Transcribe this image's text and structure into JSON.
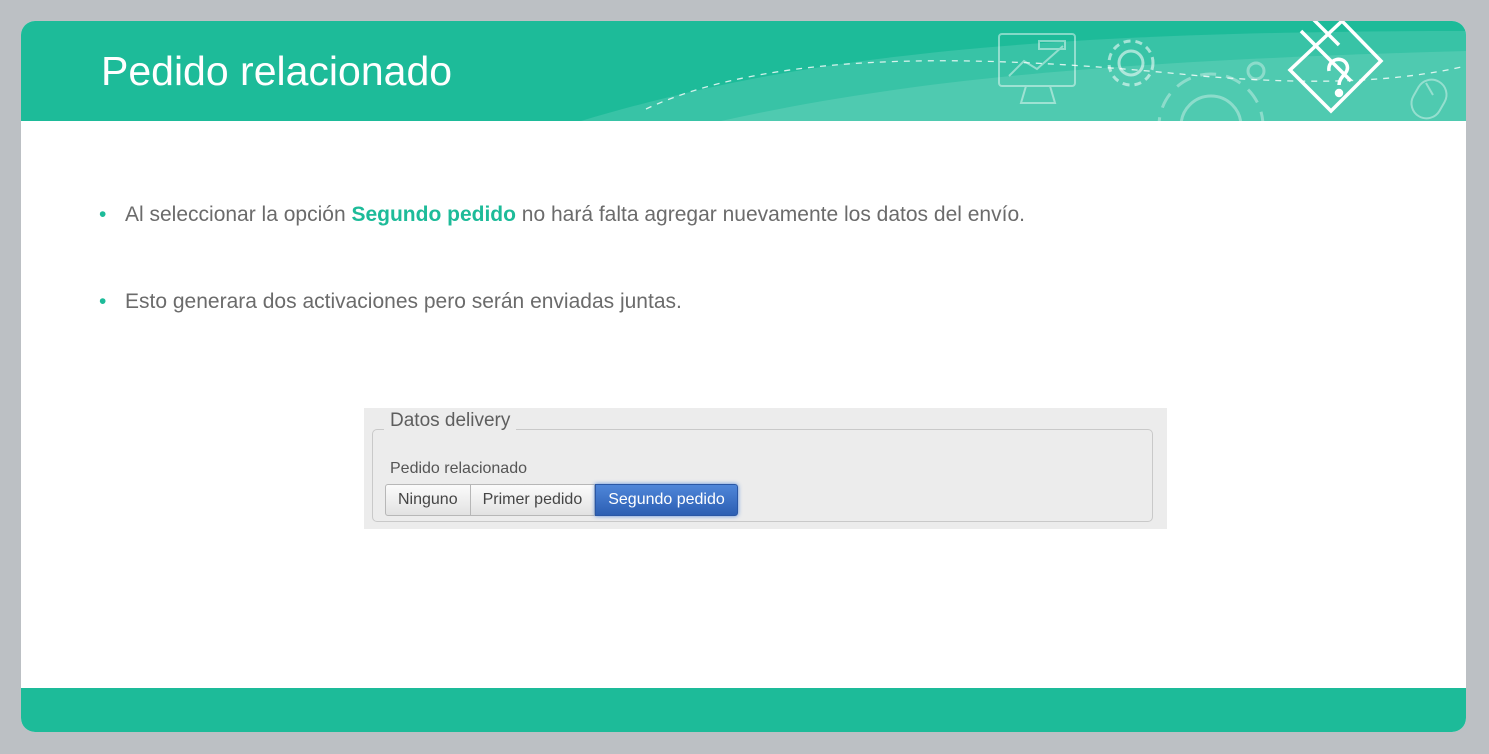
{
  "slide": {
    "title": "Pedido relacionado",
    "bullets": [
      {
        "before": "Al seleccionar la opción ",
        "highlight": "Segundo pedido",
        "after": " no hará falta agregar nuevamente los datos del envío."
      },
      {
        "text": "Esto generara dos activaciones pero serán enviadas juntas."
      }
    ]
  },
  "screenshot": {
    "group_title": "Datos delivery",
    "field_label": "Pedido relacionado",
    "options": [
      "Ninguno",
      "Primer pedido",
      "Segundo pedido"
    ],
    "selected": "Segundo pedido"
  },
  "theme": {
    "accent": "#1dbb99",
    "header_decoration_icons": [
      "monitor-chart-icon",
      "gear-icon",
      "gear-outline-icon",
      "pencil-question-icon",
      "mouse-icon"
    ]
  }
}
